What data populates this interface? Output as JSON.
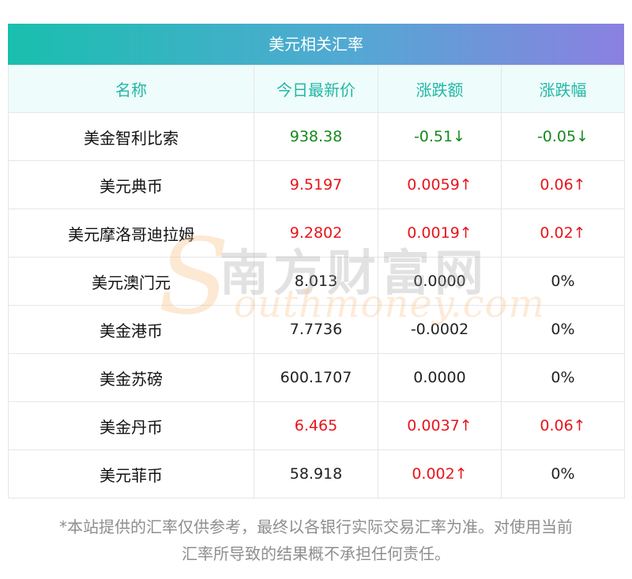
{
  "title": "美元相关汇率",
  "headers": [
    "名称",
    "今日最新价",
    "涨跌额",
    "涨跌幅"
  ],
  "rows": [
    {
      "name": "美金智利比索",
      "price": "938.38",
      "change": "-0.51↓",
      "pct": "-0.05↓",
      "dir": "down"
    },
    {
      "name": "美元典币",
      "price": "9.5197",
      "change": "0.0059↑",
      "pct": "0.06↑",
      "dir": "up"
    },
    {
      "name": "美元摩洛哥迪拉姆",
      "price": "9.2802",
      "change": "0.0019↑",
      "pct": "0.02↑",
      "dir": "up"
    },
    {
      "name": "美元澳门元",
      "price": "8.013",
      "change": "0.0000",
      "pct": "0%",
      "dir": "flat"
    },
    {
      "name": "美金港币",
      "price": "7.7736",
      "change": "-0.0002",
      "pct": "0%",
      "dir": "flat"
    },
    {
      "name": "美金苏磅",
      "price": "600.1707",
      "change": "0.0000",
      "pct": "0%",
      "dir": "flat"
    },
    {
      "name": "美金丹币",
      "price": "6.465",
      "change": "0.0037↑",
      "pct": "0.06↑",
      "dir": "up"
    },
    {
      "name": "美元菲币",
      "price": "58.918",
      "change": "0.002↑",
      "pct": "0%",
      "dir": "mixed"
    }
  ],
  "footnote_line1": "*本站提供的汇率仅供参考，最终以各银行实际交易汇率为准。对使用当前",
  "footnote_line2": "汇率所导致的结果概不承担任何责任。",
  "watermark": {
    "letter": "S",
    "cn": "南方财富网",
    "en": "outhmoney.com"
  },
  "colors": {
    "up": "#e8141b",
    "down": "#158a1c",
    "header_text": "#22b8a6",
    "gradient_start": "#19bfae",
    "gradient_end": "#8b80e0"
  }
}
